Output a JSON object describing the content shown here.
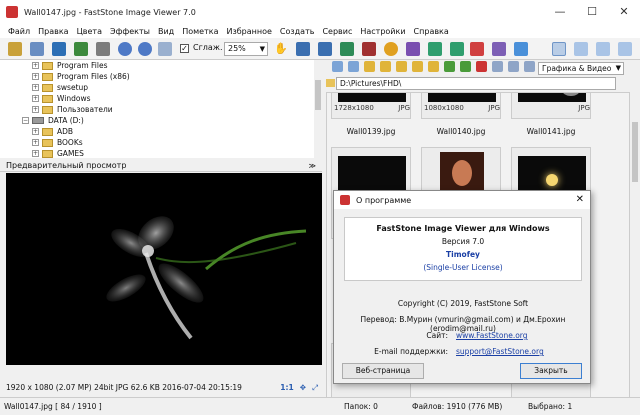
{
  "window": {
    "title": "Wall0147.jpg  -  FastStone Image Viewer 7.0",
    "controls": [
      "—",
      "☐",
      "✕"
    ]
  },
  "menu": [
    "Файл",
    "Правка",
    "Цвета",
    "Эффекты",
    "Вид",
    "Пометка",
    "Избранное",
    "Создать",
    "Сервис",
    "Настройки",
    "Справка"
  ],
  "toolbar": {
    "smooth_label": "Сглаж.",
    "zoom_value": "25%"
  },
  "tree": [
    {
      "label": "Program Files",
      "exp": "+"
    },
    {
      "label": "Program Files (x86)",
      "exp": "+"
    },
    {
      "label": "swsetup",
      "exp": "+"
    },
    {
      "label": "Windows",
      "exp": "+"
    },
    {
      "label": "Пользователи",
      "exp": "+"
    },
    {
      "label": "DATA (D:)",
      "exp": "−"
    },
    {
      "label": "ADB",
      "exp": "+"
    },
    {
      "label": "BOOKs",
      "exp": "+"
    },
    {
      "label": "GAMES",
      "exp": "+"
    }
  ],
  "preview": {
    "header": "Предварительный просмотр",
    "info": "1920 x 1080 (2.07 MP)  24bit  JPG   62.6 KB   2016-07-04 20:15:19",
    "ratio": "1:1"
  },
  "browser": {
    "sort": "Графика & Видео",
    "path": "D:\\Pictures\\FHD\\",
    "thumbs": [
      {
        "name": "Wall0139.jpg",
        "res": "1728x1080",
        "ext": "JPG"
      },
      {
        "name": "Wall0140.jpg",
        "res": "1080x1080",
        "ext": "JPG"
      },
      {
        "name": "Wall0141.jpg",
        "res": "",
        "ext": "JPG"
      }
    ]
  },
  "status": {
    "file": "Wall0147.jpg [ 84 / 1910 ]",
    "folders": "Папок: 0",
    "files": "Файлов: 1910 (776 MB)",
    "selected": "Выбрано: 1"
  },
  "about": {
    "title": "О программе",
    "product": "FastStone Image Viewer для Windows",
    "version": "Версия 7.0",
    "registered": "Timofey",
    "license": "(Single-User License)",
    "copyright": "Copyright (C) 2019, FastStone Soft",
    "translation": "Перевод: В.Мурин (vmurin@gmail.com) и Дм.Ерохин (erodim@mail.ru)",
    "site_label": "Сайт:",
    "site": "www.FastStone.org",
    "email_label": "E-mail поддержки:",
    "email": "support@FastStone.org",
    "web_button": "Веб-страница",
    "close_button": "Закрыть"
  },
  "colors": {
    "accent": "#3c7fd1",
    "link": "#1a3fa5"
  }
}
